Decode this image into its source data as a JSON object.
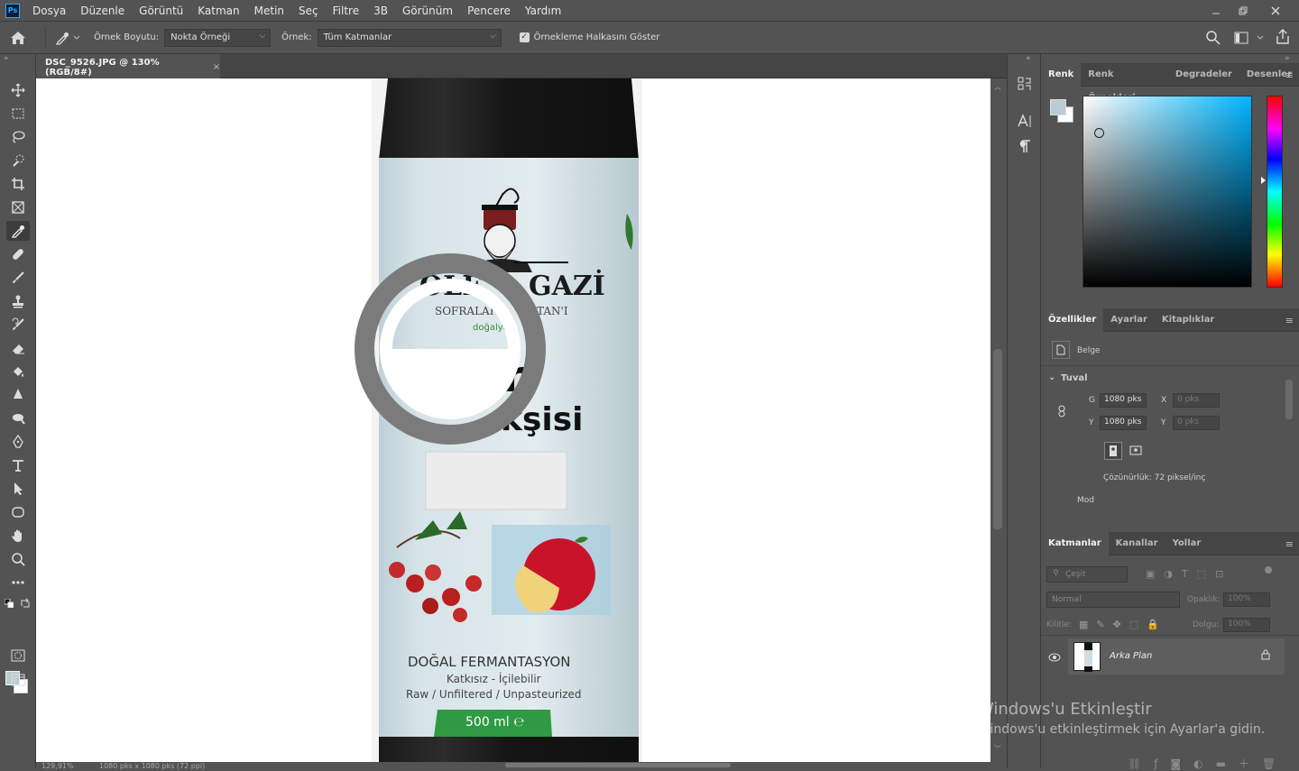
{
  "menubar": {
    "logo": "Ps",
    "items": [
      "Dosya",
      "Düzenle",
      "Görüntü",
      "Katman",
      "Metin",
      "Seç",
      "Filtre",
      "3B",
      "Görünüm",
      "Pencere",
      "Yardım"
    ]
  },
  "options": {
    "sample_size_label": "Örnek Boyutu:",
    "sample_size_value": "Nokta Örneği",
    "sample_label": "Örnek:",
    "sample_value": "Tüm Katmanlar",
    "show_ring_label": "Örnekleme Halkasını Göster"
  },
  "document": {
    "tab_title": "DSC_9526.JPG @ 130% (RGB/8#)"
  },
  "label_art": {
    "brand_part": "GAZİ",
    "brand_left": "ÖLE",
    "sofralari": "SOFRALARI",
    "tan": "TAN'I",
    "dogalyas": "doğalyas",
    "product_big": "Nar",
    "product_big2": "kşisi",
    "fermentation": "DOĞAL FERMANTASYON",
    "line2": "Katkısız - İçilebilir",
    "line3": "Raw / Unfiltered / Unpasteurized",
    "volume": "500 ml ℮"
  },
  "status": {
    "zoom": "129,91%",
    "dims": "1080 pks x 1080 pks (72 ppi)"
  },
  "color_panel": {
    "tabs": [
      "Renk",
      "Renk Örnekleri",
      "Degradeler",
      "Desenler"
    ],
    "foreground": "#b9ccd4",
    "background": "#ffffff"
  },
  "properties_panel": {
    "tabs": [
      "Özellikler",
      "Ayarlar",
      "Kitaplıklar"
    ],
    "doc_label": "Belge",
    "canvas_section": "Tuval",
    "w_label": "G",
    "w_value": "1080 pks",
    "h_label": "Y",
    "h_value": "1080 pks",
    "x_label": "X",
    "x_value": "0 pks",
    "y_label": "Y",
    "y_value": "0 pks",
    "resolution": "Çözünürlük: 72 piksel/inç",
    "mode_label": "Mod"
  },
  "layers_panel": {
    "tabs": [
      "Katmanlar",
      "Kanallar",
      "Yollar"
    ],
    "filter_placeholder": "Çeşit",
    "blend_mode": "Normal",
    "opacity_label": "Opaklık:",
    "opacity_value": "100%",
    "lock_label": "Kilitle:",
    "fill_label": "Dolgu:",
    "fill_value": "100%",
    "layer_name": "Arka Plan"
  },
  "watermark": {
    "line1": "Windows'u Etkinleştir",
    "line2": "Windows'u etkinleştirmek için Ayarlar'a gidin."
  }
}
